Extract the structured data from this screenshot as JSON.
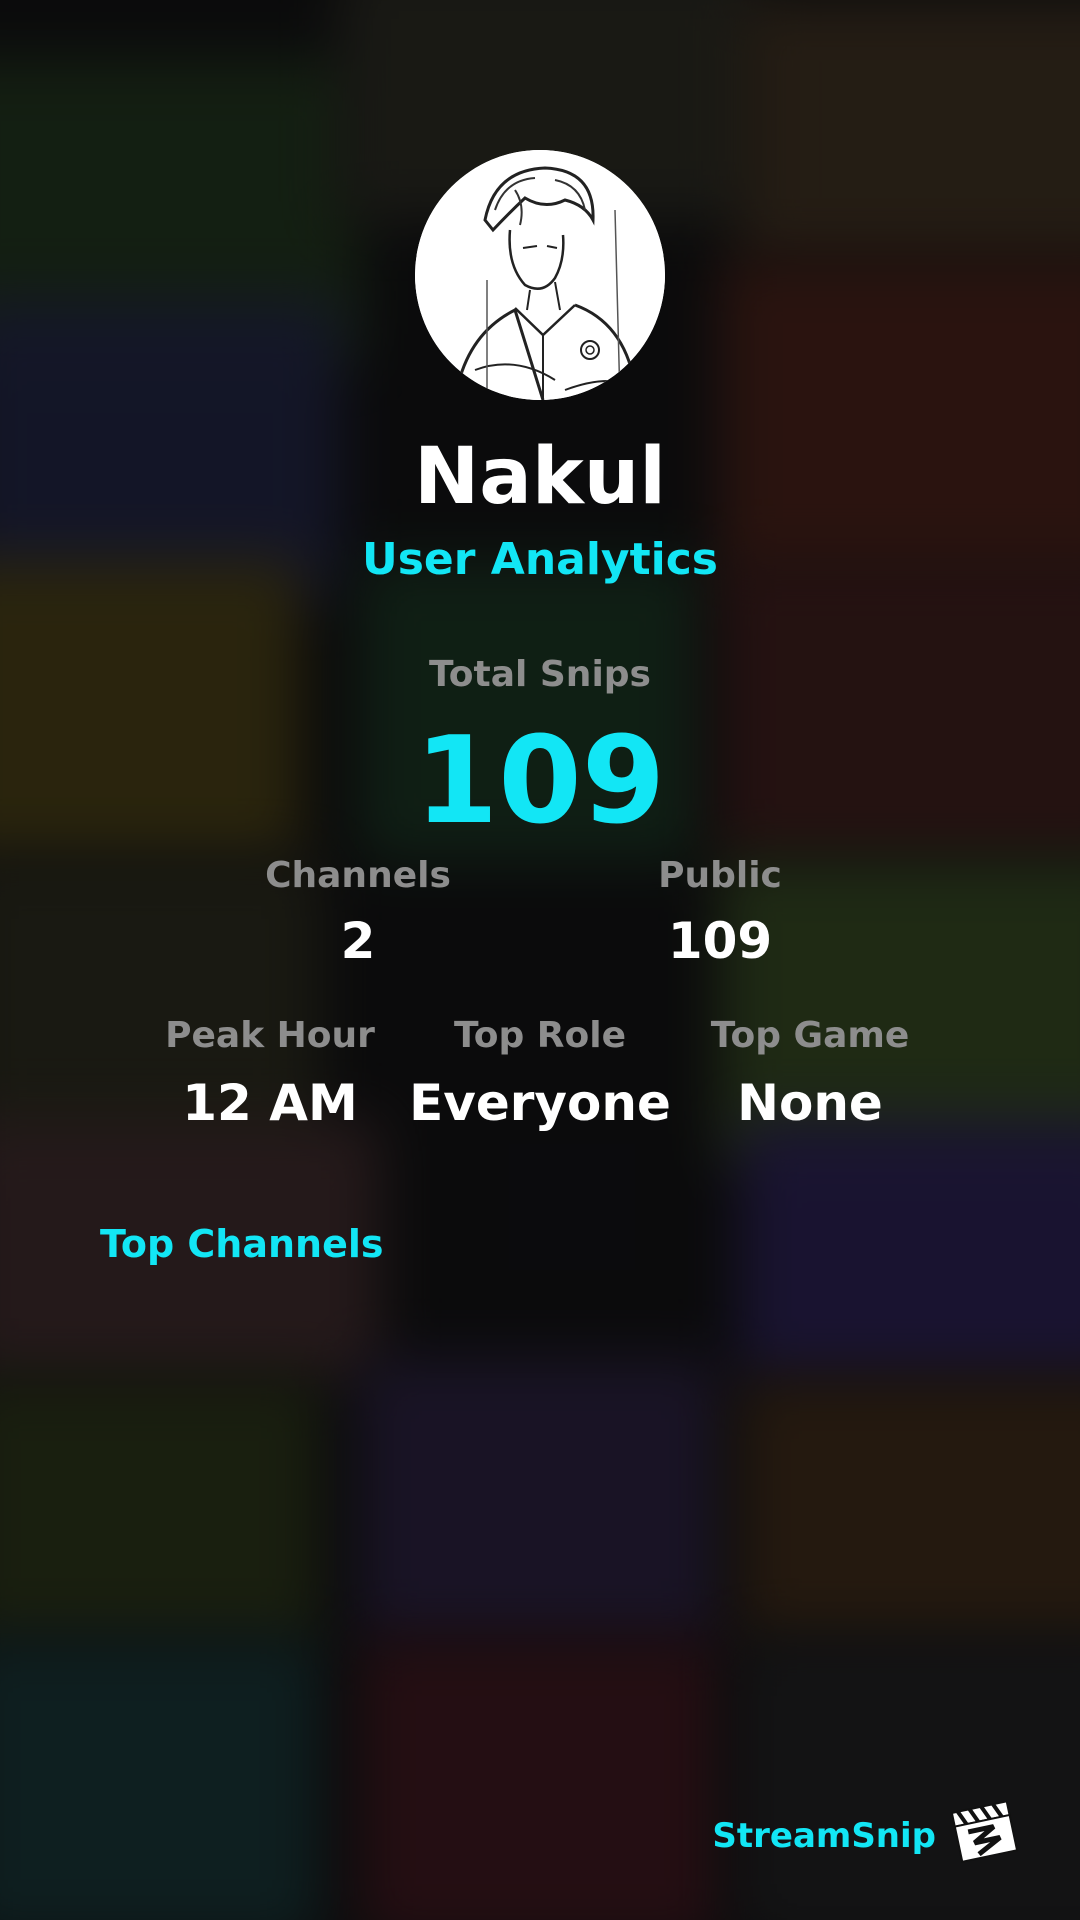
{
  "profile": {
    "name": "Nakul",
    "subtitle": "User Analytics"
  },
  "stats": {
    "total_snips_label": "Total Snips",
    "total_snips_value": "109",
    "channels_label": "Channels",
    "channels_value": "2",
    "public_label": "Public",
    "public_value": "109",
    "peak_hour_label": "Peak Hour",
    "peak_hour_value": "12 AM",
    "top_role_label": "Top Role",
    "top_role_value": "Everyone",
    "top_game_label": "Top Game",
    "top_game_value": "None"
  },
  "sections": {
    "top_channels_title": "Top Channels"
  },
  "footer": {
    "brand": "StreamSnip",
    "brand_icon": "clapperboard-icon"
  },
  "colors": {
    "accent": "#12e6f5",
    "label": "#8d8d8d",
    "text": "#ffffff"
  }
}
